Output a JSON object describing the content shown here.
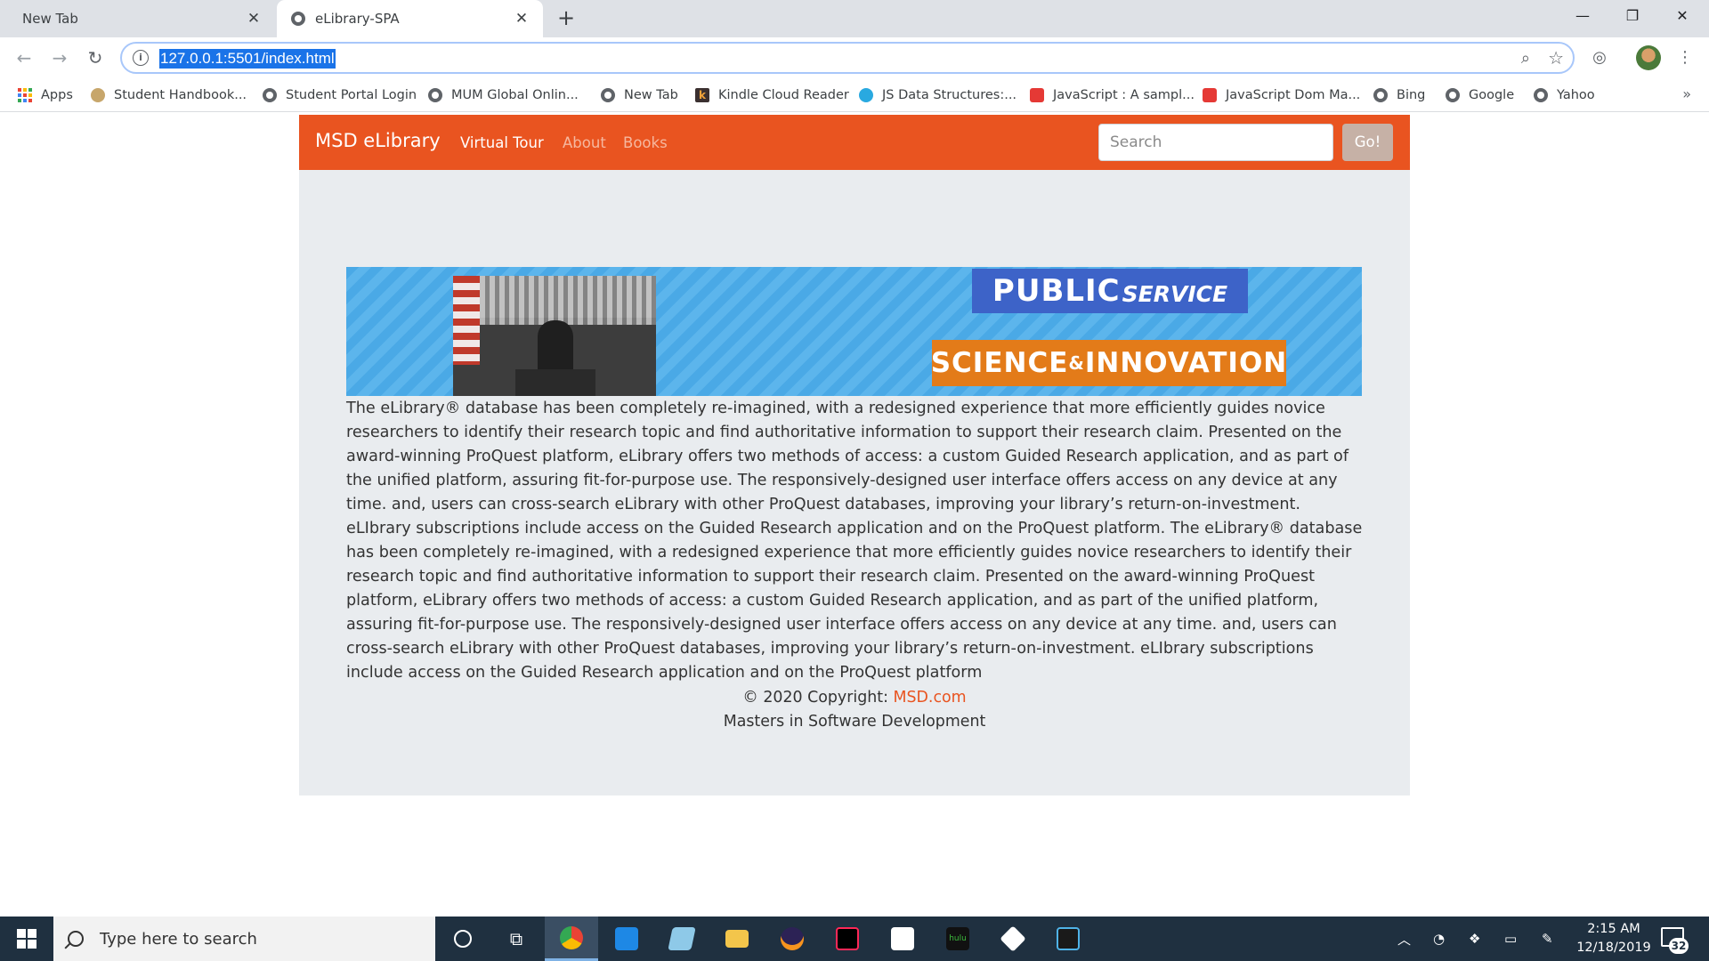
{
  "browser": {
    "tabs": [
      {
        "title": "New Tab",
        "active": false
      },
      {
        "title": "eLibrary-SPA",
        "active": true
      }
    ],
    "url": "127.0.0.1:5501/index.html",
    "bookmarks": [
      {
        "label": "Apps",
        "icon": "apps-grid-icon"
      },
      {
        "label": "Student Handbook...",
        "icon": "handbook-icon"
      },
      {
        "label": "Student Portal Login",
        "icon": "globe-icon"
      },
      {
        "label": "MUM Global Onlin...",
        "icon": "globe-icon"
      },
      {
        "label": "New Tab",
        "icon": "globe-icon"
      },
      {
        "label": "Kindle Cloud Reader",
        "icon": "kindle-icon"
      },
      {
        "label": "JS Data Structures:...",
        "icon": "ds-icon"
      },
      {
        "label": "JavaScript : A sampl...",
        "icon": "js-icon"
      },
      {
        "label": "JavaScript Dom Ma...",
        "icon": "js-c-icon"
      },
      {
        "label": "Bing",
        "icon": "globe-icon"
      },
      {
        "label": "Google",
        "icon": "globe-icon"
      },
      {
        "label": "Yahoo",
        "icon": "globe-icon"
      }
    ]
  },
  "site": {
    "brand": "MSD eLibrary",
    "nav": [
      {
        "label": "Virtual Tour",
        "active": true
      },
      {
        "label": "About",
        "active": false
      },
      {
        "label": "Books",
        "active": false
      }
    ],
    "search_placeholder": "Search",
    "search_button": "Go!",
    "banner": {
      "public": "PUBLIC",
      "service": "SERVICE",
      "science": "SCIENCE",
      "amp": "&",
      "innovation": "INNOVATION"
    },
    "body": "The eLibrary® database has been completely re-imagined, with a redesigned experience that more efficiently guides novice researchers to identify their research topic and find authoritative information to support their research claim. Presented on the award-winning ProQuest platform, eLibrary offers two methods of access: a custom Guided Research application, and as part of the unified platform, assuring fit-for-purpose use. The responsively-designed user interface offers access on any device at any time. and, users can cross-search eLibrary with other ProQuest databases, improving your library’s return-on-investment. eLIbrary subscriptions include access on the Guided Research application and on the ProQuest platform. The eLibrary® database has been completely re-imagined, with a redesigned experience that more efficiently guides novice researchers to identify their research topic and find authoritative information to support their research claim. Presented on the award-winning ProQuest platform, eLibrary offers two methods of access: a custom Guided Research application, and as part of the unified platform, assuring fit-for-purpose use. The responsively-designed user interface offers access on any device at any time. and, users can cross-search eLibrary with other ProQuest databases, improving your library’s return-on-investment. eLIbrary subscriptions include access on the Guided Research application and on the ProQuest platform",
    "footer": {
      "copyright_prefix": "© 2020 Copyright: ",
      "copyright_link": "MSD.com",
      "tagline": "Masters in Software Development"
    },
    "colors": {
      "navbar": "#e95420",
      "page_bg": "#e9ecef",
      "link": "#e95420"
    }
  },
  "taskbar": {
    "search_placeholder": "Type here to search",
    "time": "2:15 AM",
    "date": "12/18/2019",
    "notification_count": "32"
  }
}
